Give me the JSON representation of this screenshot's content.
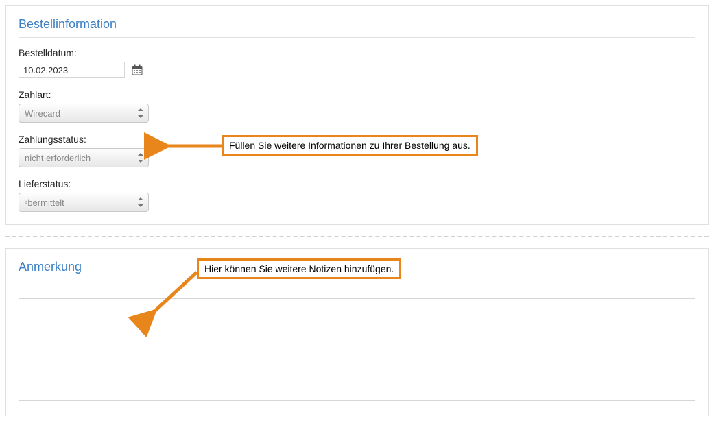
{
  "order_info": {
    "title": "Bestellinformation",
    "date_label": "Bestelldatum:",
    "date_value": "10.02.2023",
    "payment_method_label": "Zahlart:",
    "payment_method_value": "Wirecard",
    "payment_status_label": "Zahlungsstatus:",
    "payment_status_value": "nicht erforderlich",
    "delivery_status_label": "Lieferstatus:",
    "delivery_status_value": "³bermittelt",
    "callout_text": "Füllen Sie weitere Informationen zu Ihrer Bestellung aus."
  },
  "note": {
    "title": "Anmerkung",
    "callout_text": "Hier können Sie weitere Notizen hinzufügen.",
    "value": ""
  }
}
